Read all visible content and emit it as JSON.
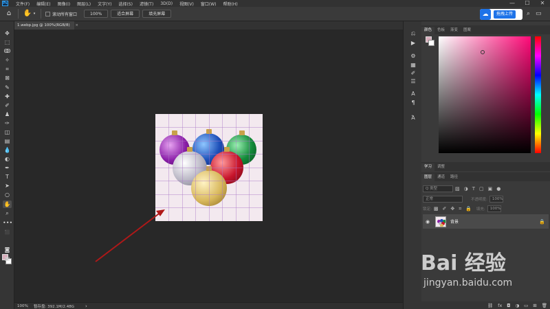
{
  "app": {
    "logo": "Ps",
    "menu": [
      "文件(F)",
      "编辑(E)",
      "图像(I)",
      "图层(L)",
      "文字(Y)",
      "选择(S)",
      "滤镜(T)",
      "3D(D)",
      "视图(V)",
      "窗口(W)",
      "帮助(H)"
    ],
    "window_controls": [
      "—",
      "☐",
      "✕"
    ]
  },
  "options_bar": {
    "scroll_all_label": "滚动所有窗口",
    "zoom_value": "100%",
    "fit_screen_label": "适合屏幕",
    "fill_screen_label": "填充屏幕",
    "cloud_upload_label": "拖拽上传"
  },
  "document": {
    "tab_title": "1.webp.jpg @ 100%(RGB/8)",
    "tab_close": "×"
  },
  "status": {
    "zoom": "100%",
    "info": "暂存盘: 392.1M/2.48G",
    "arrow": "›"
  },
  "color_panel": {
    "tabs": [
      "颜色",
      "色板",
      "渐变",
      "图案"
    ],
    "fg_color": "#d9aebc",
    "bg_color": "#ffffff"
  },
  "learn_panel": {
    "tabs": [
      "学习",
      "调整"
    ]
  },
  "layers_panel": {
    "tabs": [
      "图层",
      "通道",
      "路径"
    ],
    "filter_placeholder": "Q 类型",
    "blend_mode": "正常",
    "opacity_label": "不透明度:",
    "opacity_value": "100%",
    "lock_label": "锁定:",
    "fill_label": "填充:",
    "fill_value": "100%",
    "layers": [
      {
        "name": "背景",
        "visible": true,
        "locked": true
      }
    ]
  },
  "watermark": {
    "text": "Bai 经验",
    "sub": "jingyan.baidu.com"
  }
}
